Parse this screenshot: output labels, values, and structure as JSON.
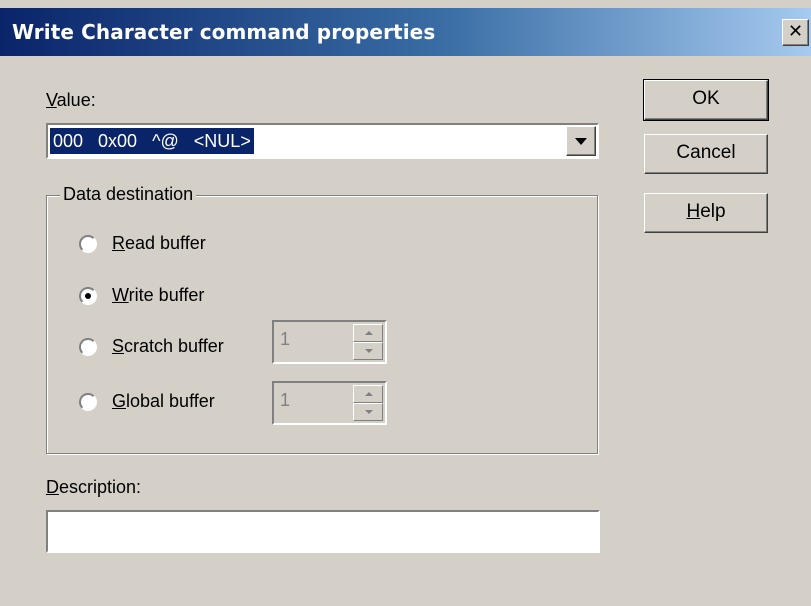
{
  "dialog": {
    "title": "Write Character command properties",
    "close_glyph": "✕"
  },
  "value": {
    "label_accel": "V",
    "label_rest": "alue:",
    "selected": "000   0x00   ^@   <NUL>"
  },
  "buttons": {
    "ok": "OK",
    "cancel": "Cancel",
    "help_accel": "H",
    "help_rest": "elp"
  },
  "data_destination": {
    "legend": "Data destination",
    "options": [
      {
        "accel": "R",
        "rest": "ead buffer",
        "checked": false
      },
      {
        "accel": "W",
        "rest": "rite buffer",
        "checked": true
      },
      {
        "accel": "S",
        "rest": "cratch buffer",
        "checked": false,
        "spin_value": "1"
      },
      {
        "accel": "G",
        "rest": "lobal buffer",
        "checked": false,
        "spin_value": "1"
      }
    ]
  },
  "description": {
    "label_accel": "D",
    "label_rest": "escription:",
    "value": ""
  },
  "icons": {
    "close": "close-icon",
    "dropdown": "chevron-down-icon",
    "spin_up": "spin-up-arrow-icon",
    "spin_down": "spin-down-arrow-icon"
  },
  "colors": {
    "face": "#d4d0c8",
    "title_start": "#0a246a",
    "title_end": "#a6caf0",
    "selection": "#0a246a"
  }
}
